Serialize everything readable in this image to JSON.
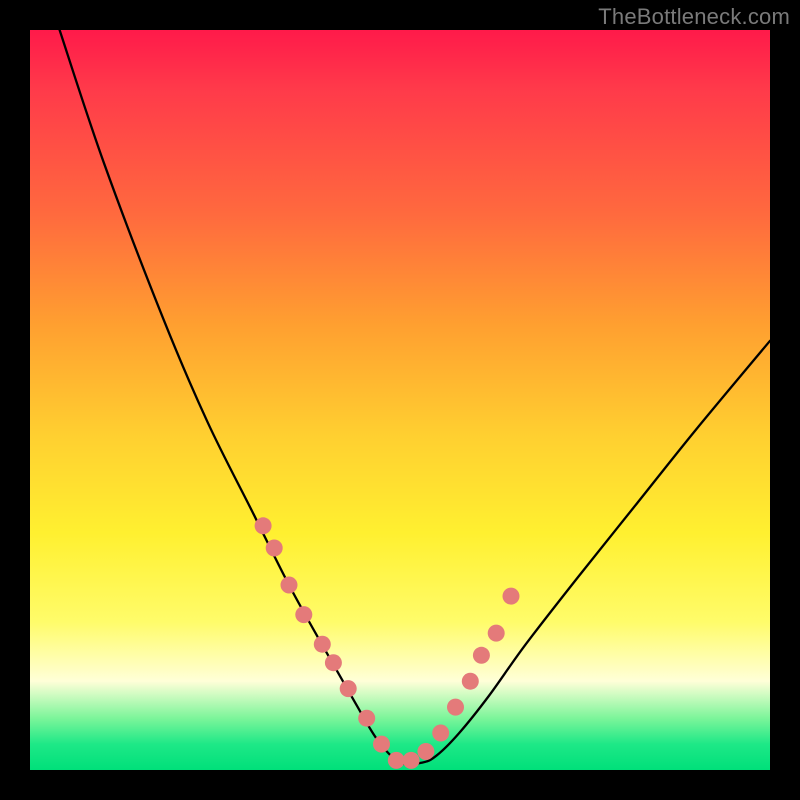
{
  "watermark": "TheBottleneck.com",
  "chart_data": {
    "type": "line",
    "title": "",
    "xlabel": "",
    "ylabel": "",
    "xlim": [
      0,
      100
    ],
    "ylim": [
      0,
      100
    ],
    "grid": false,
    "series": [
      {
        "name": "bottleneck-curve",
        "x": [
          4,
          10,
          18,
          24,
          30,
          35,
          40,
          44,
          47,
          50,
          53,
          55,
          58,
          62,
          67,
          74,
          82,
          90,
          100
        ],
        "values": [
          100,
          82,
          61,
          47,
          35,
          25,
          16,
          9,
          4,
          1,
          1,
          2,
          5,
          10,
          17,
          26,
          36,
          46,
          58
        ]
      }
    ],
    "markers": {
      "name": "threshold-dots",
      "x": [
        31.5,
        33.0,
        35.0,
        37.0,
        39.5,
        41.0,
        43.0,
        45.5,
        47.5,
        49.5,
        51.5,
        53.5,
        55.5,
        57.5,
        59.5,
        61.0,
        63.0,
        65.0
      ],
      "values": [
        33.0,
        30.0,
        25.0,
        21.0,
        17.0,
        14.5,
        11.0,
        7.0,
        3.5,
        1.3,
        1.3,
        2.5,
        5.0,
        8.5,
        12.0,
        15.5,
        18.5,
        23.5
      ]
    },
    "gradient_stops": [
      {
        "pct": 0,
        "color": "#ff1a4a"
      },
      {
        "pct": 8,
        "color": "#ff3a4a"
      },
      {
        "pct": 25,
        "color": "#ff6a3e"
      },
      {
        "pct": 40,
        "color": "#ffa030"
      },
      {
        "pct": 55,
        "color": "#ffd030"
      },
      {
        "pct": 68,
        "color": "#fff030"
      },
      {
        "pct": 80,
        "color": "#fffc6a"
      },
      {
        "pct": 88,
        "color": "#ffffd8"
      },
      {
        "pct": 93,
        "color": "#7cf59a"
      },
      {
        "pct": 96.5,
        "color": "#1ee887"
      },
      {
        "pct": 100,
        "color": "#00e07a"
      }
    ]
  }
}
